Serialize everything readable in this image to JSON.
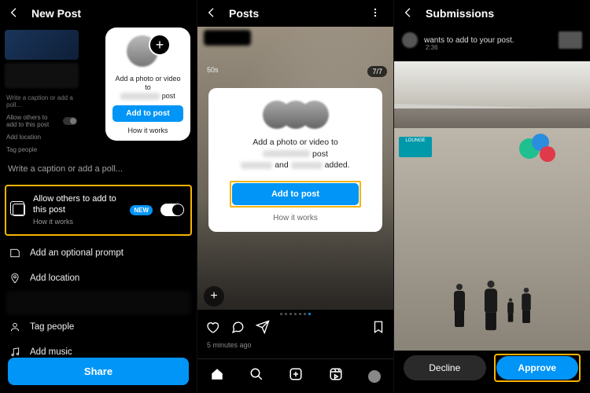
{
  "panel1": {
    "title": "New Post",
    "mini": {
      "caption": "Write a caption or add a poll...",
      "allow": "Allow others to add to this post",
      "hiw": "How it works",
      "location": "Add location",
      "tag": "Tag people"
    },
    "card": {
      "line": "Add a photo or video to",
      "line2": "post",
      "btn": "Add to post",
      "link": "How it works"
    },
    "caption": "Write a caption or add a poll...",
    "allow": {
      "title": "Allow others to add to this post",
      "hiw": "How it works",
      "badge": "NEW"
    },
    "rows": {
      "prompt": "Add an optional prompt",
      "location": "Add location",
      "tag": "Tag people",
      "music": "Add music"
    },
    "share": "Share"
  },
  "panel2": {
    "title": "Posts",
    "counter": "7/7",
    "elapsed": "50s",
    "card": {
      "line1": "Add a photo or video to",
      "line2": "post",
      "line3a": "and",
      "line3b": "added.",
      "btn": "Add to post",
      "link": "How it works"
    },
    "ago": "5 minutes ago"
  },
  "panel3": {
    "title": "Submissions",
    "sub": "wants to add to your post.",
    "time": "2:36",
    "lounge": "LOUNGE",
    "decline": "Decline",
    "approve": "Approve"
  }
}
